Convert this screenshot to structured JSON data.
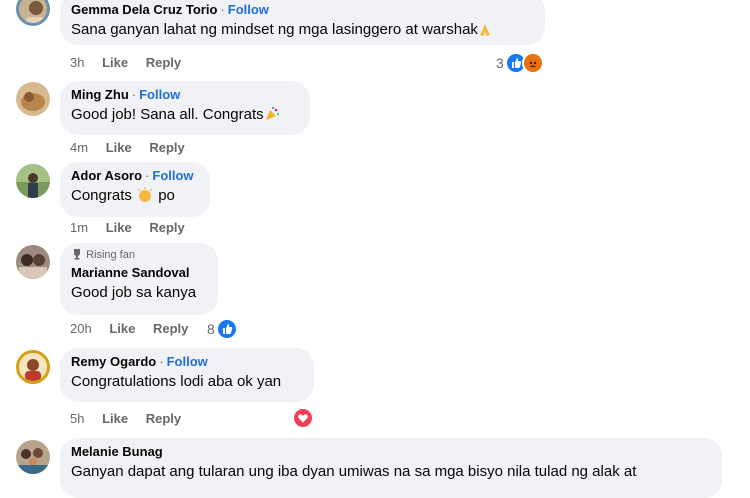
{
  "comments": [
    {
      "name": "Gemma Dela Cruz Torio",
      "follow": "Follow",
      "text": "Sana ganyan lahat ng mindset ng mga lasinggero at warshak",
      "time": "3h",
      "like": "Like",
      "reply": "Reply",
      "reactions": "3"
    },
    {
      "name": "Ming Zhu",
      "follow": "Follow",
      "text": "Good job! Sana all. Congrats",
      "time": "4m",
      "like": "Like",
      "reply": "Reply"
    },
    {
      "name": "Ador Asoro",
      "follow": "Follow",
      "text_a": "Congrats",
      "text_b": "po",
      "time": "1m",
      "like": "Like",
      "reply": "Reply"
    },
    {
      "badge": "Rising fan",
      "name": "Marianne Sandoval",
      "text": "Good job sa kanya",
      "time": "20h",
      "like": "Like",
      "reply": "Reply",
      "reactions": "8"
    },
    {
      "name": "Remy Ogardo",
      "follow": "Follow",
      "text": "Congratulations lodi aba ok yan",
      "time": "5h",
      "like": "Like",
      "reply": "Reply"
    },
    {
      "name": "Melanie Bunag",
      "text": "Ganyan dapat ang tularan ung iba dyan umiwas na sa mga bisyo nila tulad ng alak at"
    }
  ],
  "colors": {
    "link": "#216fdb",
    "bubble": "#f0f2f5",
    "meta": "#65676b",
    "like_blue": "#1877f2",
    "heart": "#f33e58",
    "angry": "#e9710f"
  }
}
